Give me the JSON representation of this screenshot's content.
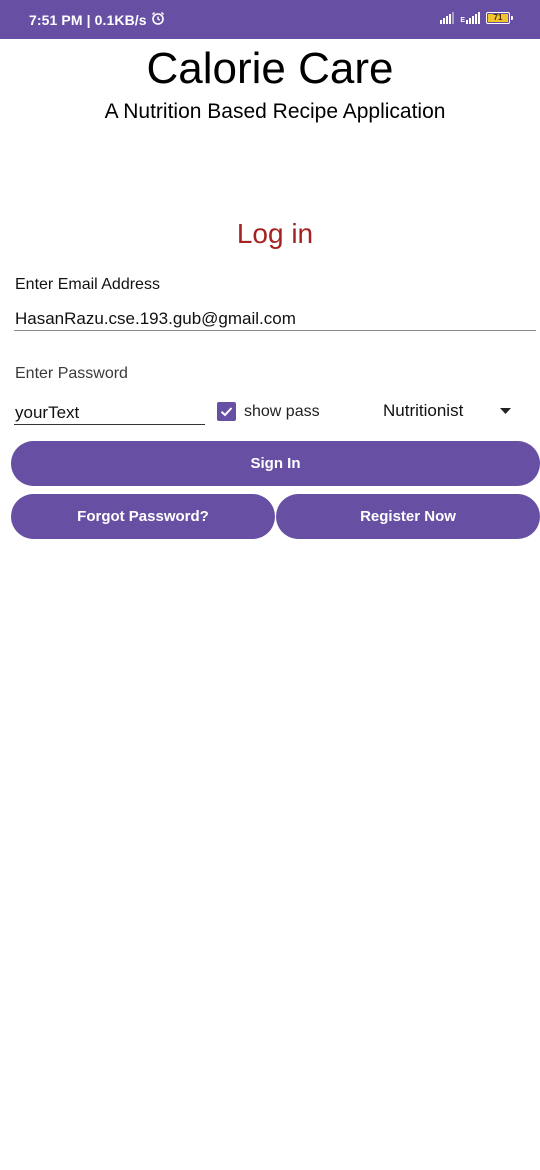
{
  "status_bar": {
    "time_speed": "7:51 PM | 0.1KB/s",
    "alarm_icon": "alarm-clock-icon",
    "network_label": "E",
    "battery_level": "71",
    "color": "#6750A4"
  },
  "app": {
    "title": "Calorie Care",
    "subtitle": "A Nutrition Based Recipe Application"
  },
  "login": {
    "heading": "Log in",
    "heading_color": "#A52222",
    "email_label": "Enter Email Address",
    "email_value": "HasanRazu.cse.193.gub@gmail.com",
    "password_label": "Enter Password",
    "password_value": "yourText",
    "show_pass_label": "show pass",
    "show_pass_checked": true,
    "role_selected": "Nutritionist",
    "sign_in_label": "Sign In",
    "forgot_label": "Forgot Password?",
    "register_label": "Register Now"
  },
  "accent_color": "#6750A4"
}
